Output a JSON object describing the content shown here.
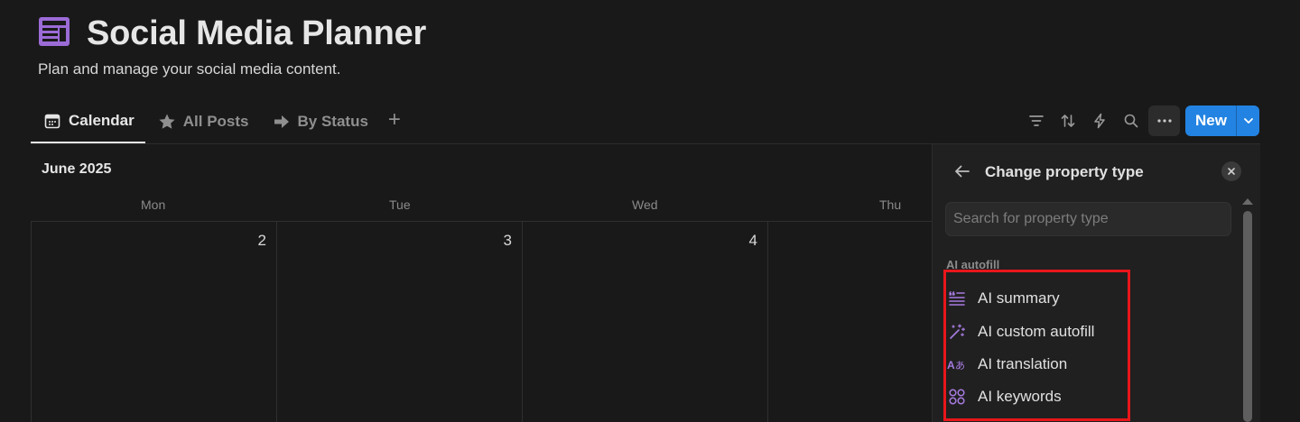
{
  "page": {
    "title": "Social Media Planner",
    "description": "Plan and manage your social media content.",
    "icon": "window-layout-icon",
    "accent": "#9b6bd6"
  },
  "tabs": [
    {
      "label": "Calendar",
      "icon": "calendar-icon",
      "active": true
    },
    {
      "label": "All Posts",
      "icon": "star-icon",
      "active": false
    },
    {
      "label": "By Status",
      "icon": "arrow-right-icon",
      "active": false
    }
  ],
  "toolbar": {
    "new_label": "New",
    "icons": [
      "filter-icon",
      "sort-icon",
      "lightning-icon",
      "search-icon",
      "more-icon"
    ],
    "brand_color": "#2383e2"
  },
  "calendar": {
    "month": "June 2025",
    "weekdays": [
      "Mon",
      "Tue",
      "Wed",
      "Thu"
    ],
    "days": [
      "2",
      "3",
      "4"
    ]
  },
  "panel": {
    "title": "Change property type",
    "search_placeholder": "Search for property type",
    "section": "AI autofill",
    "options": [
      {
        "label": "AI summary",
        "icon": "summary-lines-icon"
      },
      {
        "label": "AI custom autofill",
        "icon": "magic-wand-icon"
      },
      {
        "label": "AI translation",
        "icon": "translate-icon"
      },
      {
        "label": "AI keywords",
        "icon": "keywords-circles-icon"
      }
    ],
    "highlight_color": "#e8161a"
  }
}
